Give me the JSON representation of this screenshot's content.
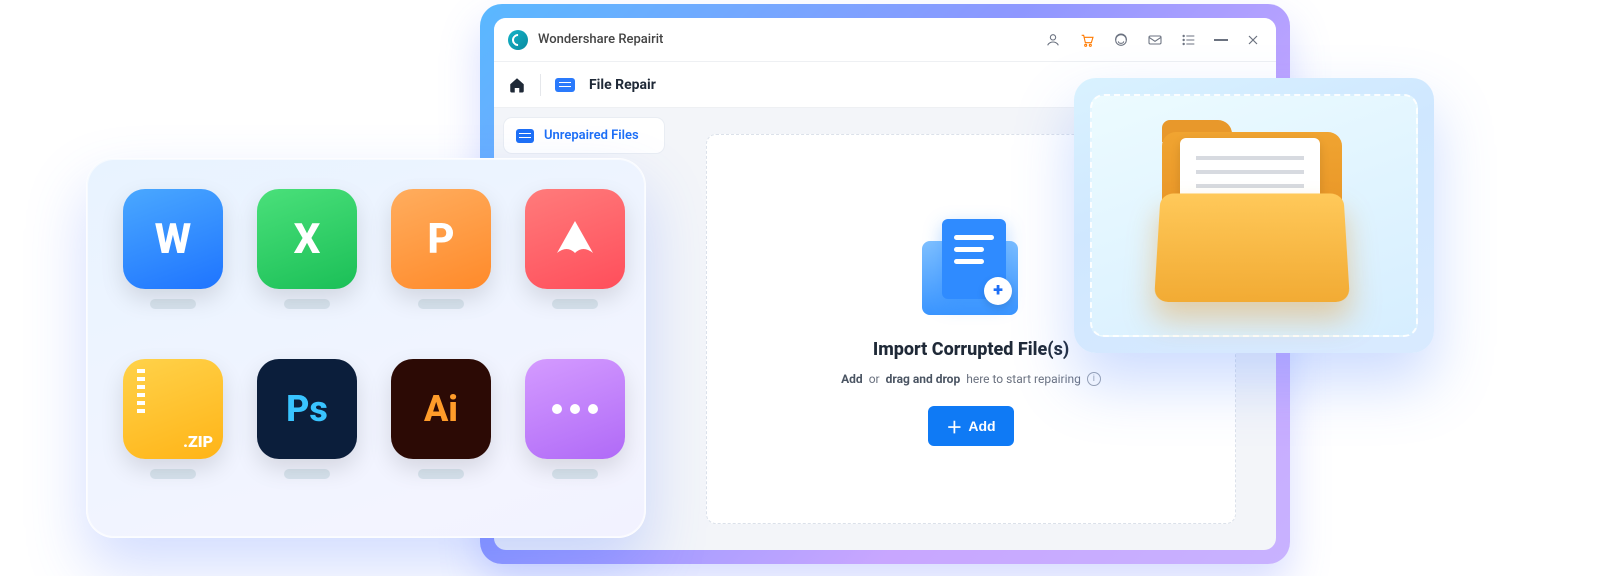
{
  "app": {
    "title": "Wondershare Repairit"
  },
  "crumb": {
    "label": "File Repair"
  },
  "sidebar": {
    "item_label": "Unrepaired Files"
  },
  "dropzone": {
    "title": "Import Corrupted File(s)",
    "sub_add": "Add",
    "sub_or": "or",
    "sub_drag": "drag and drop",
    "sub_tail": "here to start repairing",
    "add_button": "Add"
  },
  "filetypes": {
    "word": "W",
    "excel": "X",
    "powerpoint": "P",
    "zip_ext": ".ZIP",
    "ps": "Ps",
    "ai": "Ai"
  }
}
